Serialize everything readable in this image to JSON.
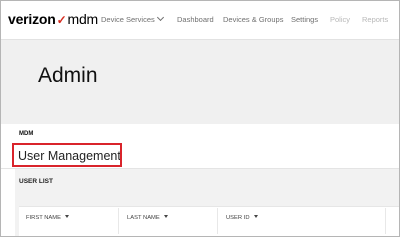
{
  "brand": {
    "verizon": "verizon",
    "check": "✓",
    "product": "mdm"
  },
  "nav": {
    "items": [
      {
        "label": "Device Services",
        "has_caret": true,
        "enabled": true
      },
      {
        "label": "Dashboard",
        "enabled": true
      },
      {
        "label": "Devices & Groups",
        "enabled": true
      },
      {
        "label": "Settings",
        "enabled": true
      },
      {
        "label": "Policy",
        "enabled": false
      },
      {
        "label": "Reports",
        "enabled": false
      }
    ]
  },
  "page": {
    "title": "Admin"
  },
  "tabs": [
    {
      "label": "MDM",
      "active": true
    }
  ],
  "section": {
    "title": "User Management",
    "highlight_color": "#d9242b"
  },
  "user_list": {
    "title": "USER LIST",
    "columns": [
      {
        "label": "FIRST NAME"
      },
      {
        "label": "LAST NAME"
      },
      {
        "label": "USER ID"
      }
    ]
  },
  "colors": {
    "accent": "#d52b1e",
    "text": "#111111",
    "muted": "#707070"
  }
}
